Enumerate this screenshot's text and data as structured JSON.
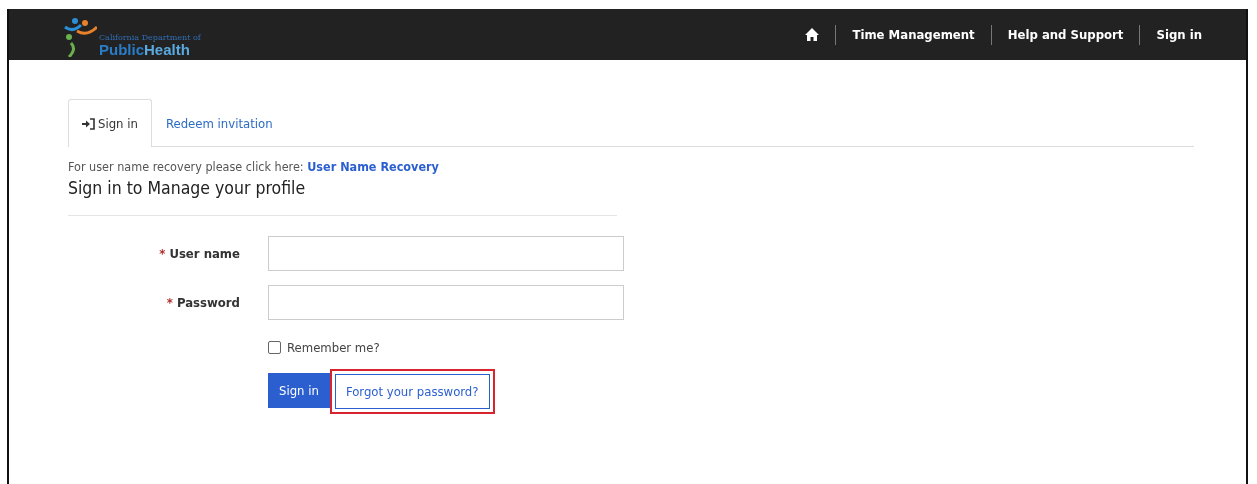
{
  "header": {
    "logo": {
      "caption": "California Department of",
      "name_parts": [
        "Public",
        "Health"
      ]
    },
    "nav": [
      {
        "kind": "home"
      },
      {
        "kind": "link",
        "label": "Time Management"
      },
      {
        "kind": "link",
        "label": "Help and Support"
      },
      {
        "kind": "link",
        "label": "Sign in"
      }
    ]
  },
  "tabs": [
    {
      "kind": "icon",
      "label": "Sign in",
      "selected": true
    },
    {
      "kind": "plain",
      "label": "Redeem invitation",
      "selected": false
    }
  ],
  "recovery": {
    "text": "For user name recovery please click here:",
    "link": "User Name Recovery"
  },
  "heading": "Sign in to Manage your profile",
  "fields": [
    {
      "label": "User name",
      "required_mark": "*"
    },
    {
      "label": "Password",
      "required_mark": "*"
    }
  ],
  "remember": {
    "label": "Remember me?",
    "checked": false
  },
  "buttons": [
    {
      "kind": "primary",
      "label": "Sign in",
      "highlighted": false
    },
    {
      "kind": "secondary",
      "label": "Forgot your password?",
      "highlighted": true
    }
  ]
}
